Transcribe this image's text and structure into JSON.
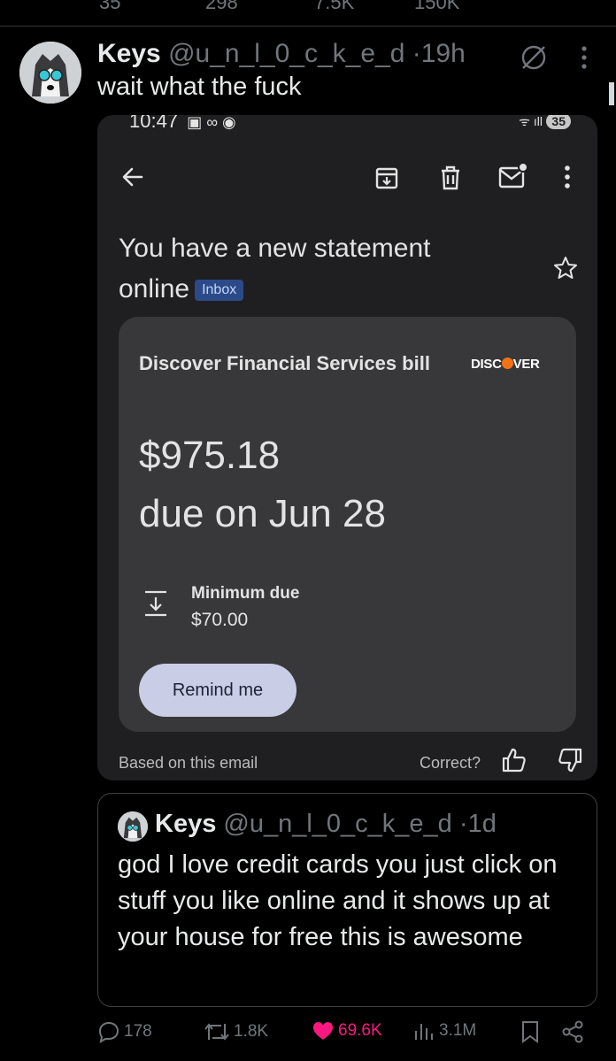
{
  "top_counts": {
    "replies": "35",
    "reposts": "298",
    "likes": "7.5K",
    "views": "150K"
  },
  "tweet": {
    "name": "Keys",
    "handle": "@u_n_l_0_c_k_e_d",
    "dot": "·",
    "time": "19h",
    "text": "wait what the fuck"
  },
  "screenshot": {
    "status_time": "10:47",
    "battery": "35",
    "subject": "You have a new statement online",
    "inbox_label": "Inbox",
    "card": {
      "title": "Discover Financial Services bill",
      "logo_left": "DISC",
      "logo_right": "VER",
      "amount": "$975.18",
      "due": "due on Jun 28",
      "minimum_label": "Minimum due",
      "minimum_value": "$70.00",
      "remind_label": "Remind me"
    },
    "based_on": "Based on this email",
    "correct": "Correct?"
  },
  "quote": {
    "name": "Keys",
    "handle": "@u_n_l_0_c_k_e_d",
    "dot": "·",
    "time": "1d",
    "text": "god I love credit cards you just click on stuff you like online and it shows up at your house for free this is awesome"
  },
  "actions": {
    "replies": "178",
    "reposts": "1.8K",
    "likes": "69.6K",
    "views": "3.1M"
  },
  "colors": {
    "like": "#f91880",
    "muted": "#71767b",
    "discover_orange": "#f47216"
  }
}
